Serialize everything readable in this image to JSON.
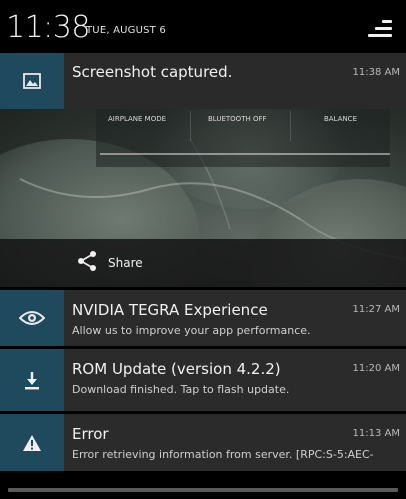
{
  "status": {
    "time": "11:38",
    "date": "TUE, AUGUST 6",
    "qs_icon": "quick-settings-icon"
  },
  "screenshot_notification": {
    "icon": "image-icon",
    "title": "Screenshot captured.",
    "time": "11:38 AM",
    "preview": {
      "toggles": [
        "AIRPLANE MODE",
        "BLUETOOTH OFF",
        "BALANCE"
      ]
    },
    "action": {
      "icon": "share-icon",
      "label": "Share"
    }
  },
  "notifications": [
    {
      "icon": "nvidia-eye-icon",
      "title": "NVIDIA TEGRA Experience",
      "text": "Allow us to improve your app performance.",
      "time": "11:27 AM"
    },
    {
      "icon": "download-icon",
      "title": "ROM Update (version 4.2.2)",
      "text": "Download finished. Tap to flash update.",
      "time": "11:20 AM"
    },
    {
      "icon": "warning-icon",
      "title": "Error",
      "text": "Error retrieving information from server. [RPC:S-5:AEC-",
      "time": "11:13 AM"
    }
  ],
  "colors": {
    "icon_background": "#1f4a5e",
    "row_background": "#2b2b2b"
  }
}
